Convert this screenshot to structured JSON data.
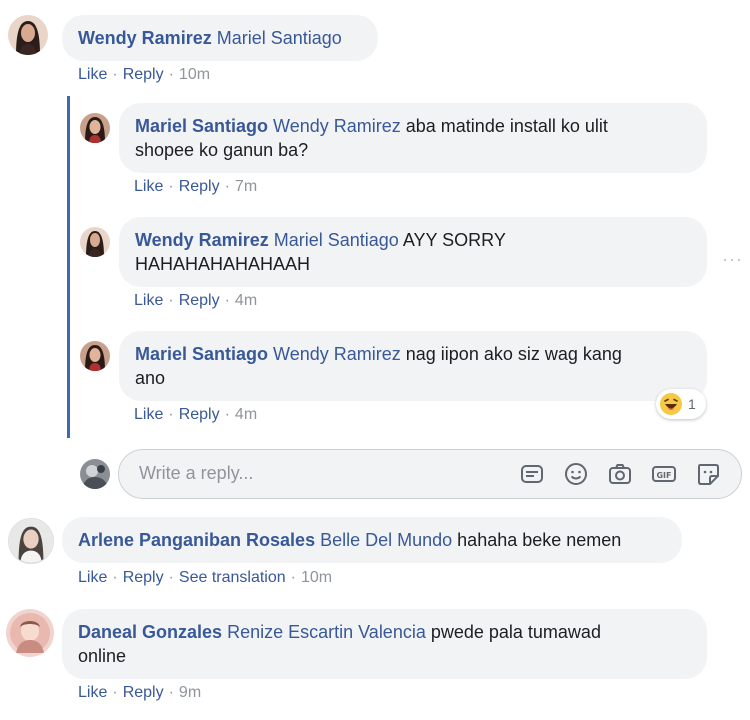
{
  "comments": [
    {
      "author": "Wendy Ramirez",
      "tag": "Mariel Santiago",
      "text": "",
      "actions": {
        "like": "Like",
        "reply": "Reply",
        "time": "10m"
      }
    },
    {
      "author": "Mariel Santiago",
      "tag": "Wendy Ramirez",
      "text_line1": " aba matinde install ko ulit",
      "text_line2": "shopee ko ganun ba?",
      "actions": {
        "like": "Like",
        "reply": "Reply",
        "time": "7m"
      }
    },
    {
      "author": "Wendy Ramirez",
      "tag": "Mariel Santiago",
      "text_line1": " AYY SORRY",
      "text_line2": "HAHAHAHAHAHAAH",
      "actions": {
        "like": "Like",
        "reply": "Reply",
        "time": "4m"
      }
    },
    {
      "author": "Mariel Santiago",
      "tag": "Wendy Ramirez",
      "text_line1": " nag iipon ako siz wag kang",
      "text_line2": "ano",
      "actions": {
        "like": "Like",
        "reply": "Reply",
        "time": "4m"
      },
      "reaction": {
        "icon": "haha-emoji-icon",
        "count": "1"
      }
    },
    {
      "author": "Arlene Panganiban Rosales",
      "tag": "Belle Del Mundo",
      "text": " hahaha beke nemen",
      "actions": {
        "like": "Like",
        "reply": "Reply",
        "translate": "See translation",
        "time": "10m"
      }
    },
    {
      "author": "Daneal Gonzales",
      "tag": "Renize Escartin Valencia",
      "text_line1": " pwede pala tumawad",
      "text_line2": "online",
      "actions": {
        "like": "Like",
        "reply": "Reply",
        "time": "9m"
      }
    }
  ],
  "reply_box": {
    "placeholder": "Write a reply...",
    "icons": [
      "sticker-icon",
      "emoji-icon",
      "camera-icon",
      "gif-icon",
      "sticker-face-icon"
    ]
  },
  "more_options": "···",
  "colors": {
    "link": "#385898",
    "thread_line": "#4267b2",
    "bubble": "#f2f3f5",
    "muted": "#90949c"
  }
}
